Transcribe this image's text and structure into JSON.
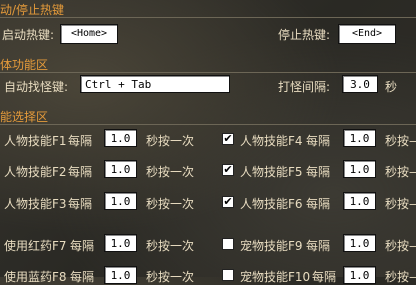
{
  "hotkey_section": {
    "title": "动/停止热键",
    "start_label": "启动热键:",
    "start_value": "<Home>",
    "stop_label": "停止热键:",
    "stop_value": "<End>"
  },
  "function_section": {
    "title": "体功能区",
    "find_label": "自动找怪键:",
    "find_value": "Ctrl + Tab",
    "interval_label": "打怪间隔:",
    "interval_value": "3.0",
    "interval_unit": "秒"
  },
  "skill_section": {
    "title": "能选择区",
    "every": "每隔",
    "press_once": "秒按一次",
    "press_once_cut": "秒按—",
    "rows": [
      {
        "left": {
          "label": "人物技能F1",
          "value": "1.0",
          "checked": false
        },
        "right": {
          "label": "人物技能F4",
          "value": "1.0",
          "checked": true
        }
      },
      {
        "left": {
          "label": "人物技能F2",
          "value": "1.0",
          "checked": false
        },
        "right": {
          "label": "人物技能F5",
          "value": "1.0",
          "checked": true
        }
      },
      {
        "left": {
          "label": "人物技能F3",
          "value": "1.0",
          "checked": false
        },
        "right": {
          "label": "人物技能F6",
          "value": "1.0",
          "checked": true
        }
      },
      {
        "left": {
          "label": "使用红药F7",
          "value": "1.0",
          "checked": false
        },
        "right": {
          "label": "宠物技能F9",
          "value": "1.0",
          "checked": false
        }
      },
      {
        "left": {
          "label": "使用蓝药F8",
          "value": "1.0",
          "checked": false
        },
        "right": {
          "label": "宠物技能F10",
          "value": "1.0",
          "checked": false
        }
      }
    ]
  },
  "check_mark": "✔"
}
